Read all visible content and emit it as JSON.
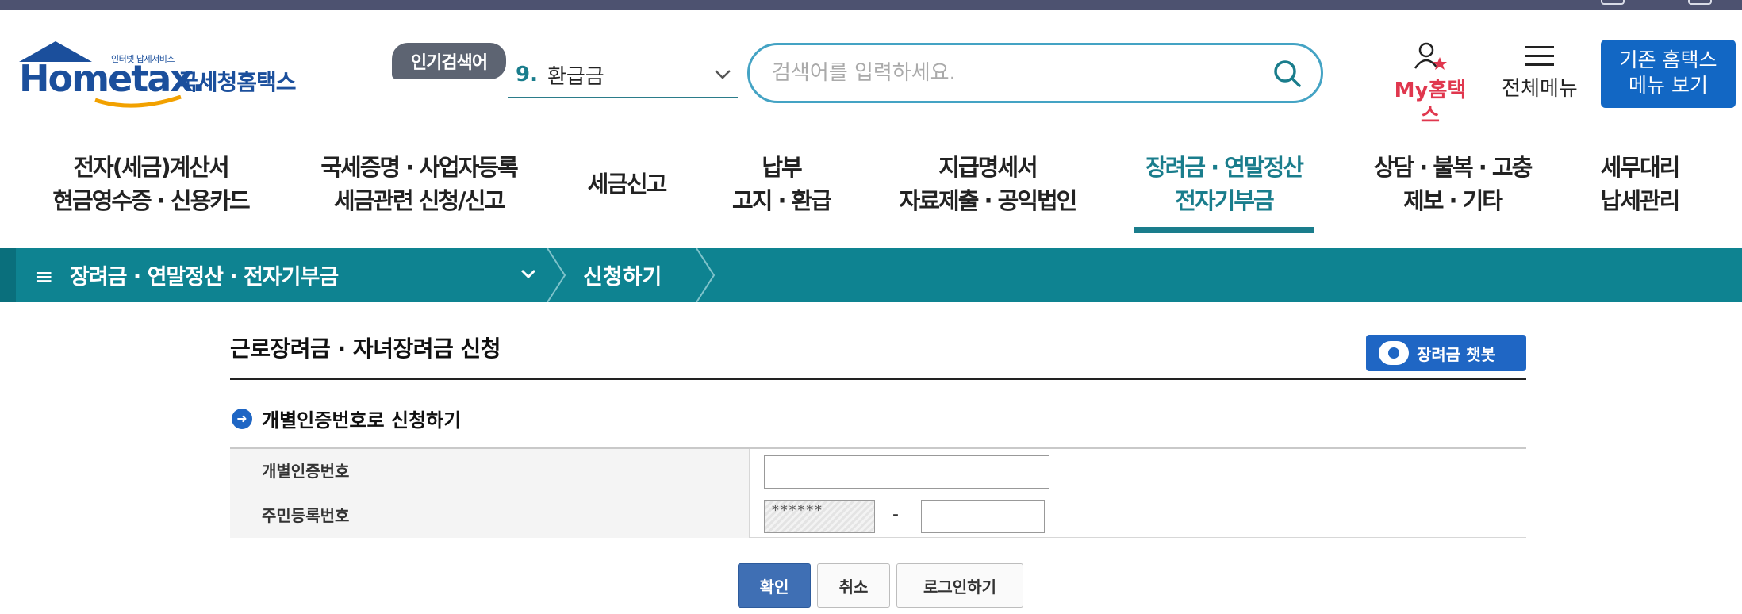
{
  "header": {
    "logo": {
      "small_text": "인터넷 납세서비스",
      "wordmark": "Hometax.",
      "korean_name": "국세청홈택스"
    },
    "popular_search": {
      "badge": "인기검색어",
      "rank": "9.",
      "term": "환급금"
    },
    "search": {
      "placeholder": "검색어를 입력하세요.",
      "value": ""
    },
    "my_hometax": "My홈택스",
    "all_menu": "전체메뉴",
    "old_menu": {
      "line1": "기존 홈택스",
      "line2": "메뉴 보기"
    }
  },
  "gnb": [
    {
      "line1": "전자(세금)계산서",
      "line2": "현금영수증 · 신용카드"
    },
    {
      "line1": "국세증명 · 사업자등록",
      "line2": "세금관련 신청/신고"
    },
    {
      "line1": "세금신고",
      "line2": ""
    },
    {
      "line1": "납부",
      "line2": "고지 · 환급"
    },
    {
      "line1": "지급명세서",
      "line2": "자료제출 · 공익법인"
    },
    {
      "line1": "장려금 · 연말정산",
      "line2": "전자기부금",
      "active": true
    },
    {
      "line1": "상담 · 불복 · 고충",
      "line2": "제보 · 기타"
    },
    {
      "line1": "세무대리",
      "line2": "납세관리"
    }
  ],
  "breadcrumb": {
    "menu": "장려금 · 연말정산 · 전자기부금",
    "current": "신청하기"
  },
  "page": {
    "title": "근로장려금 · 자녀장려금 신청",
    "chatbot_label": "장려금 챗봇",
    "section_title": "개별인증번호로 신청하기",
    "fields": {
      "auth_number_label": "개별인증번호",
      "auth_number_value": "",
      "rrn_label": "주민등록번호",
      "rrn_front_value": "******",
      "rrn_dash": "-",
      "rrn_back_value": ""
    },
    "buttons": {
      "confirm": "확인",
      "cancel": "취소",
      "login": "로그인하기"
    }
  },
  "colors": {
    "teal": "#0e8391",
    "brand_blue": "#1b4f9c",
    "accent_red": "#e0374e",
    "button_blue": "#1267c4"
  }
}
